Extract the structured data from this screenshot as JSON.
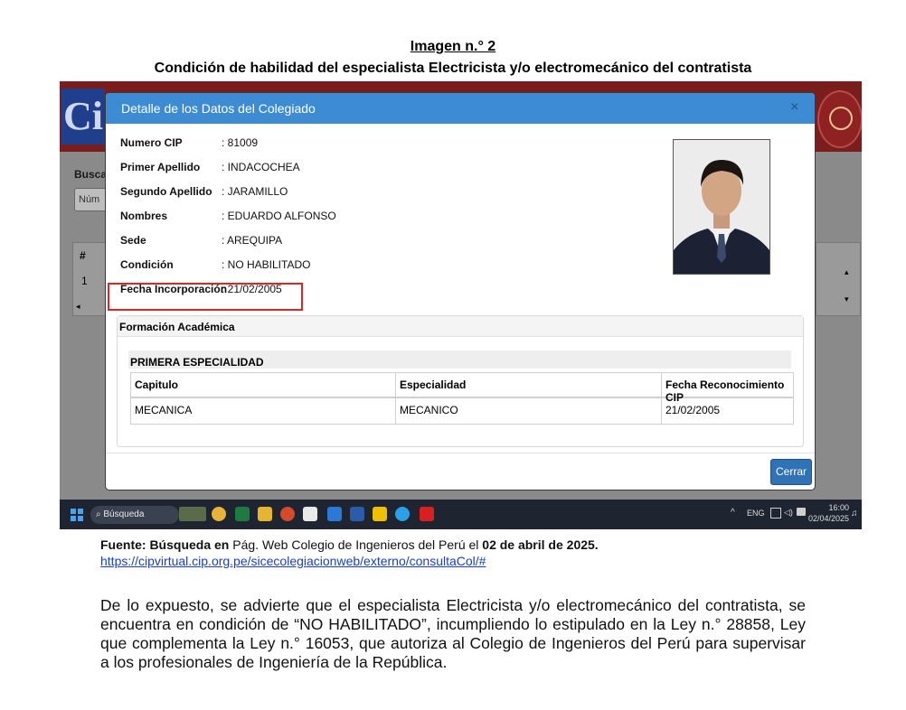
{
  "document": {
    "image_title": "Imagen n.° 2",
    "image_subtitle": "Condición de habilidad del especialista Electricista y/o electromecánico del contratista",
    "source_prefix": "Fuente: Búsqueda en",
    "source_middle": " Pág. Web Colegio de Ingenieros del Perú el ",
    "source_date": "02 de abril de 2025.",
    "source_url": "https://cipvirtual.cip.org.pe/sicecolegiacionweb/externo/consultaCol/#",
    "paragraph": "De lo expuesto, se advierte que el especialista Electricista y/o electromecánico del contratista, se encuentra en condición de “NO HABILITADO”, incumpliendo lo estipulado en la Ley n.° 28858, Ley que complementa la Ley n.° 16053, que autoriza al Colegio de Ingenieros del Perú para supervisar a los profesionales de Ingeniería de la República."
  },
  "background": {
    "logo_text": "Ci",
    "search_label": "Busca",
    "search_input": "Núm",
    "table_hash": "#",
    "table_row": "1"
  },
  "modal": {
    "title": "Detalle de los Datos del Colegiado",
    "close_glyph": "×",
    "fields": [
      {
        "label": "Numero CIP",
        "value": ": 81009"
      },
      {
        "label": "Primer Apellido",
        "value": ": INDACOCHEA"
      },
      {
        "label": "Segundo Apellido",
        "value": ": JARAMILLO"
      },
      {
        "label": "Nombres",
        "value": ": EDUARDO ALFONSO"
      },
      {
        "label": "Sede",
        "value": ": AREQUIPA"
      },
      {
        "label": "Condición",
        "value": ": NO HABILITADO"
      },
      {
        "label": "Fecha Incorporación",
        "value": ": 21/02/2005"
      }
    ],
    "formation": {
      "title": "Formación Académica",
      "specialty_title": "PRIMERA ESPECIALIDAD",
      "columns": [
        "Capitulo",
        "Especialidad",
        "Fecha Reconocimiento CIP"
      ],
      "rows": [
        [
          "MECANICA",
          "MECANICO",
          "21/02/2005"
        ]
      ]
    },
    "close_button": "Cerrar"
  },
  "taskbar": {
    "search_label": "Búsqueda",
    "tray_lang": "ENG",
    "time": "16:00",
    "date": "02/04/2025"
  },
  "colors": {
    "modal_header": "#3d8bd2",
    "highlight": "#e02424",
    "link": "#1a3fbf",
    "button": "#2f73b6"
  }
}
